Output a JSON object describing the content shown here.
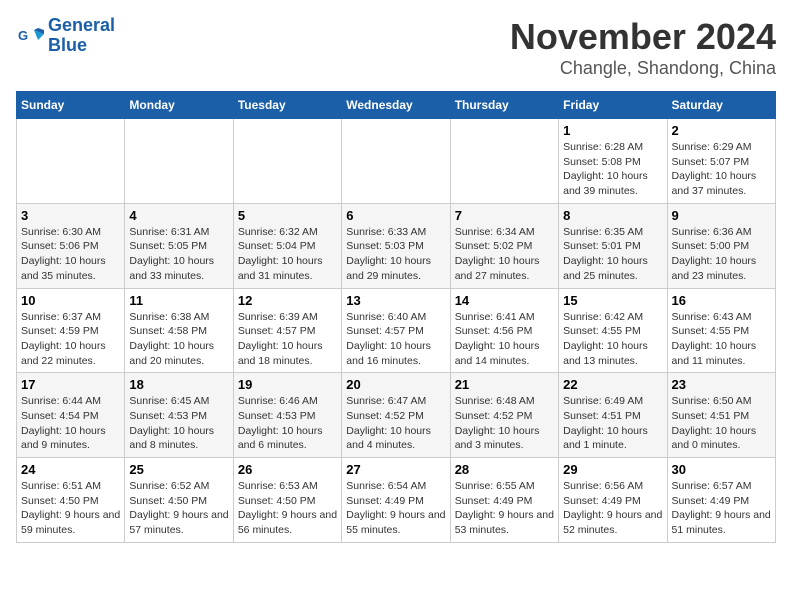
{
  "logo": {
    "line1": "General",
    "line2": "Blue"
  },
  "title": "November 2024",
  "location": "Changle, Shandong, China",
  "days_of_week": [
    "Sunday",
    "Monday",
    "Tuesday",
    "Wednesday",
    "Thursday",
    "Friday",
    "Saturday"
  ],
  "weeks": [
    [
      {
        "day": "",
        "info": ""
      },
      {
        "day": "",
        "info": ""
      },
      {
        "day": "",
        "info": ""
      },
      {
        "day": "",
        "info": ""
      },
      {
        "day": "",
        "info": ""
      },
      {
        "day": "1",
        "info": "Sunrise: 6:28 AM\nSunset: 5:08 PM\nDaylight: 10 hours and 39 minutes."
      },
      {
        "day": "2",
        "info": "Sunrise: 6:29 AM\nSunset: 5:07 PM\nDaylight: 10 hours and 37 minutes."
      }
    ],
    [
      {
        "day": "3",
        "info": "Sunrise: 6:30 AM\nSunset: 5:06 PM\nDaylight: 10 hours and 35 minutes."
      },
      {
        "day": "4",
        "info": "Sunrise: 6:31 AM\nSunset: 5:05 PM\nDaylight: 10 hours and 33 minutes."
      },
      {
        "day": "5",
        "info": "Sunrise: 6:32 AM\nSunset: 5:04 PM\nDaylight: 10 hours and 31 minutes."
      },
      {
        "day": "6",
        "info": "Sunrise: 6:33 AM\nSunset: 5:03 PM\nDaylight: 10 hours and 29 minutes."
      },
      {
        "day": "7",
        "info": "Sunrise: 6:34 AM\nSunset: 5:02 PM\nDaylight: 10 hours and 27 minutes."
      },
      {
        "day": "8",
        "info": "Sunrise: 6:35 AM\nSunset: 5:01 PM\nDaylight: 10 hours and 25 minutes."
      },
      {
        "day": "9",
        "info": "Sunrise: 6:36 AM\nSunset: 5:00 PM\nDaylight: 10 hours and 23 minutes."
      }
    ],
    [
      {
        "day": "10",
        "info": "Sunrise: 6:37 AM\nSunset: 4:59 PM\nDaylight: 10 hours and 22 minutes."
      },
      {
        "day": "11",
        "info": "Sunrise: 6:38 AM\nSunset: 4:58 PM\nDaylight: 10 hours and 20 minutes."
      },
      {
        "day": "12",
        "info": "Sunrise: 6:39 AM\nSunset: 4:57 PM\nDaylight: 10 hours and 18 minutes."
      },
      {
        "day": "13",
        "info": "Sunrise: 6:40 AM\nSunset: 4:57 PM\nDaylight: 10 hours and 16 minutes."
      },
      {
        "day": "14",
        "info": "Sunrise: 6:41 AM\nSunset: 4:56 PM\nDaylight: 10 hours and 14 minutes."
      },
      {
        "day": "15",
        "info": "Sunrise: 6:42 AM\nSunset: 4:55 PM\nDaylight: 10 hours and 13 minutes."
      },
      {
        "day": "16",
        "info": "Sunrise: 6:43 AM\nSunset: 4:55 PM\nDaylight: 10 hours and 11 minutes."
      }
    ],
    [
      {
        "day": "17",
        "info": "Sunrise: 6:44 AM\nSunset: 4:54 PM\nDaylight: 10 hours and 9 minutes."
      },
      {
        "day": "18",
        "info": "Sunrise: 6:45 AM\nSunset: 4:53 PM\nDaylight: 10 hours and 8 minutes."
      },
      {
        "day": "19",
        "info": "Sunrise: 6:46 AM\nSunset: 4:53 PM\nDaylight: 10 hours and 6 minutes."
      },
      {
        "day": "20",
        "info": "Sunrise: 6:47 AM\nSunset: 4:52 PM\nDaylight: 10 hours and 4 minutes."
      },
      {
        "day": "21",
        "info": "Sunrise: 6:48 AM\nSunset: 4:52 PM\nDaylight: 10 hours and 3 minutes."
      },
      {
        "day": "22",
        "info": "Sunrise: 6:49 AM\nSunset: 4:51 PM\nDaylight: 10 hours and 1 minute."
      },
      {
        "day": "23",
        "info": "Sunrise: 6:50 AM\nSunset: 4:51 PM\nDaylight: 10 hours and 0 minutes."
      }
    ],
    [
      {
        "day": "24",
        "info": "Sunrise: 6:51 AM\nSunset: 4:50 PM\nDaylight: 9 hours and 59 minutes."
      },
      {
        "day": "25",
        "info": "Sunrise: 6:52 AM\nSunset: 4:50 PM\nDaylight: 9 hours and 57 minutes."
      },
      {
        "day": "26",
        "info": "Sunrise: 6:53 AM\nSunset: 4:50 PM\nDaylight: 9 hours and 56 minutes."
      },
      {
        "day": "27",
        "info": "Sunrise: 6:54 AM\nSunset: 4:49 PM\nDaylight: 9 hours and 55 minutes."
      },
      {
        "day": "28",
        "info": "Sunrise: 6:55 AM\nSunset: 4:49 PM\nDaylight: 9 hours and 53 minutes."
      },
      {
        "day": "29",
        "info": "Sunrise: 6:56 AM\nSunset: 4:49 PM\nDaylight: 9 hours and 52 minutes."
      },
      {
        "day": "30",
        "info": "Sunrise: 6:57 AM\nSunset: 4:49 PM\nDaylight: 9 hours and 51 minutes."
      }
    ]
  ]
}
